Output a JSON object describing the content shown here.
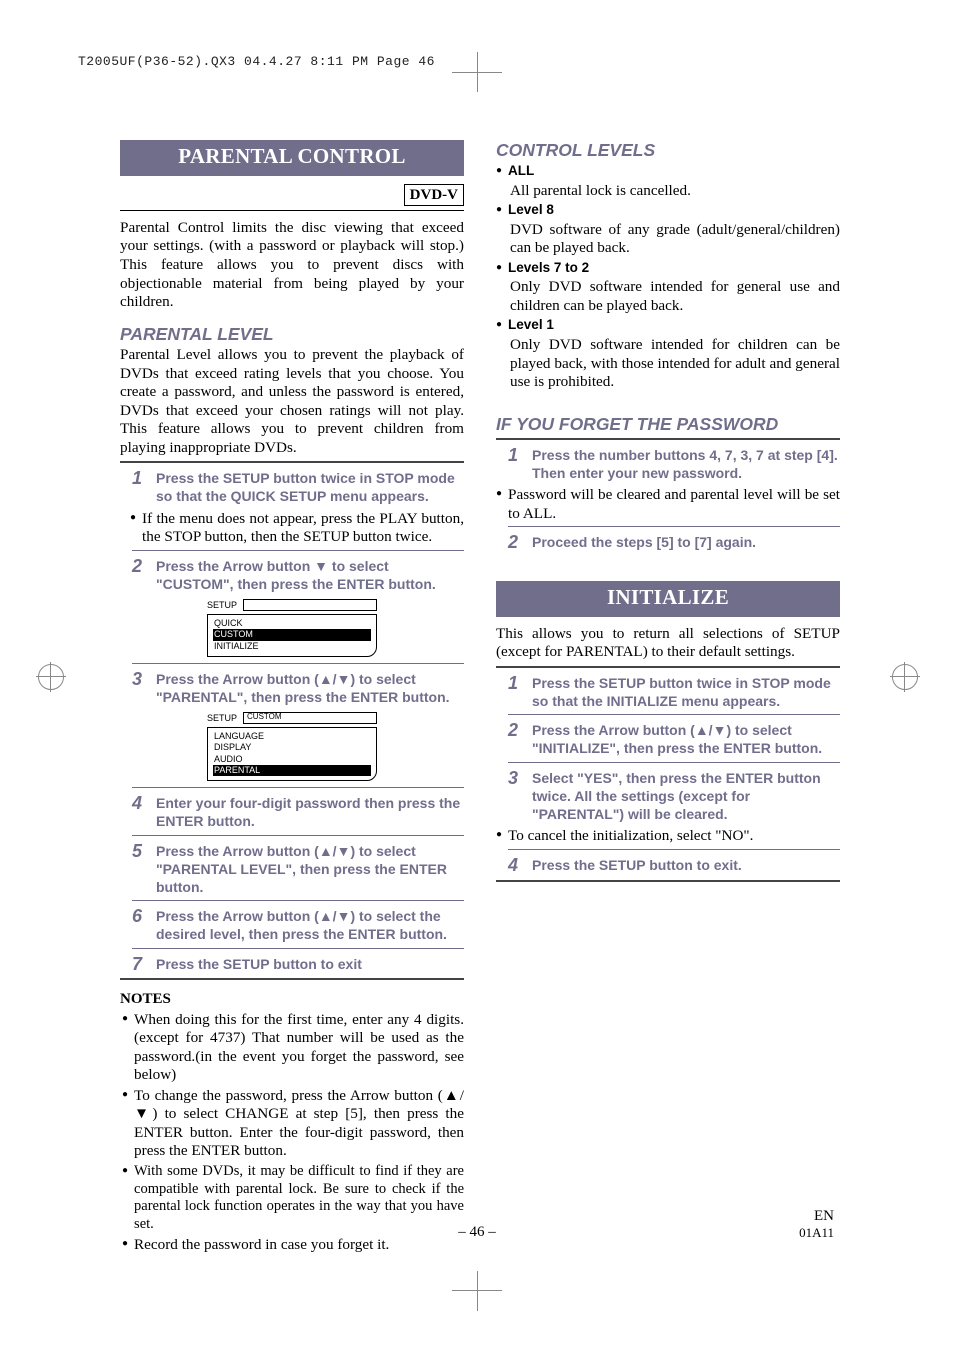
{
  "annot": "T2005UF(P36-52).QX3  04.4.27  8:11 PM  Page 46",
  "left": {
    "banner": "PARENTAL CONTROL",
    "badge": "DVD-V",
    "intro": "Parental Control limits the disc viewing that exceed your settings. (with a password or playback will stop.) This feature allows you to prevent discs with objectionable material from being played by your children.",
    "h2a": "PARENTAL LEVEL",
    "p_level": "Parental Level allows you to prevent the playback of DVDs that exceed rating levels that you choose. You create a password, and unless the password is entered, DVDs that exceed your chosen ratings will not play. This feature allows you to prevent children from playing inappropriate DVDs.",
    "step1": "Press the SETUP button twice in STOP mode so that the QUICK SETUP menu appears.",
    "bullet1": "If the menu does not appear, press the PLAY button, the STOP button, then the SETUP button twice.",
    "step2a": "Press the Arrow button ",
    "step2b": " to select \"CUSTOM\", then press the ENTER button.",
    "ui1": {
      "title": "SETUP",
      "items": [
        "QUICK",
        "CUSTOM",
        "INITIALIZE"
      ],
      "hl": 1
    },
    "step3a": "Press the Arrow button (",
    "step3b": ") to select \"PARENTAL\", then press the ENTER button.",
    "ui2": {
      "title": "SETUP",
      "bar": "CUSTOM",
      "items": [
        "LANGUAGE",
        "DISPLAY",
        "AUDIO",
        "PARENTAL"
      ],
      "hl": 3
    },
    "step4": "Enter your four-digit password then press the ENTER button.",
    "step5a": "Press the Arrow button (",
    "step5b": ") to select \"PARENTAL LEVEL\", then press the ENTER button.",
    "step6a": "Press the Arrow button (",
    "step6b": ") to select the desired level, then press the ENTER button.",
    "step7": "Press the SETUP button to exit",
    "notes_title": "NOTES",
    "note1": "When doing this for the first time, enter any 4 digits. (except for 4737) That number will be used as the password.(in the event you forget the password, see below)",
    "note2a": "To change the password, press the Arrow button (",
    "note2b": ") to select CHANGE at step [5], then press the ENTER button. Enter the four-digit password, then press the ENTER button.",
    "note3": "With some DVDs, it may be difficult to find if they are compatible with parental lock. Be sure to check if the parental lock function operates in the way that you have set.",
    "note4": "Record the password in case you forget it."
  },
  "right": {
    "h2a": "CONTROL LEVELS",
    "levels": [
      {
        "label": "ALL",
        "body": "All parental lock is cancelled."
      },
      {
        "label": "Level 8",
        "body": "DVD software of any grade (adult/general/children) can be played back."
      },
      {
        "label": "Levels 7 to 2",
        "body": "Only DVD software intended for general use and children can be played back."
      },
      {
        "label": "Level 1",
        "body": "Only DVD software intended for children can be played back, with those intended for adult and general use is prohibited."
      }
    ],
    "h2b": "IF YOU FORGET THE PASSWORD",
    "fstep1": "Press the number buttons 4, 7, 3, 7 at step [4]. Then enter your new password.",
    "fbullet": "Password will be cleared and parental level will be set to ALL.",
    "fstep2": "Proceed the steps [5] to [7] again.",
    "banner": "INITIALIZE",
    "iintro": "This allows you to return all selections of SETUP (except for PARENTAL) to their default settings.",
    "istep1": "Press the SETUP button twice in STOP mode so that the INITIALIZE menu appears.",
    "istep2a": "Press the Arrow button (",
    "istep2b": ") to select \"INITIALIZE\", then press the ENTER button.",
    "istep3": "Select \"YES\", then press the ENTER button twice. All the settings (except for \"PARENTAL\") will be cleared.",
    "ibullet": "To cancel the initialization, select \"NO\".",
    "istep4": "Press the SETUP button to exit."
  },
  "footer": {
    "page": "– 46 –",
    "en": "EN",
    "code": "01A11"
  }
}
